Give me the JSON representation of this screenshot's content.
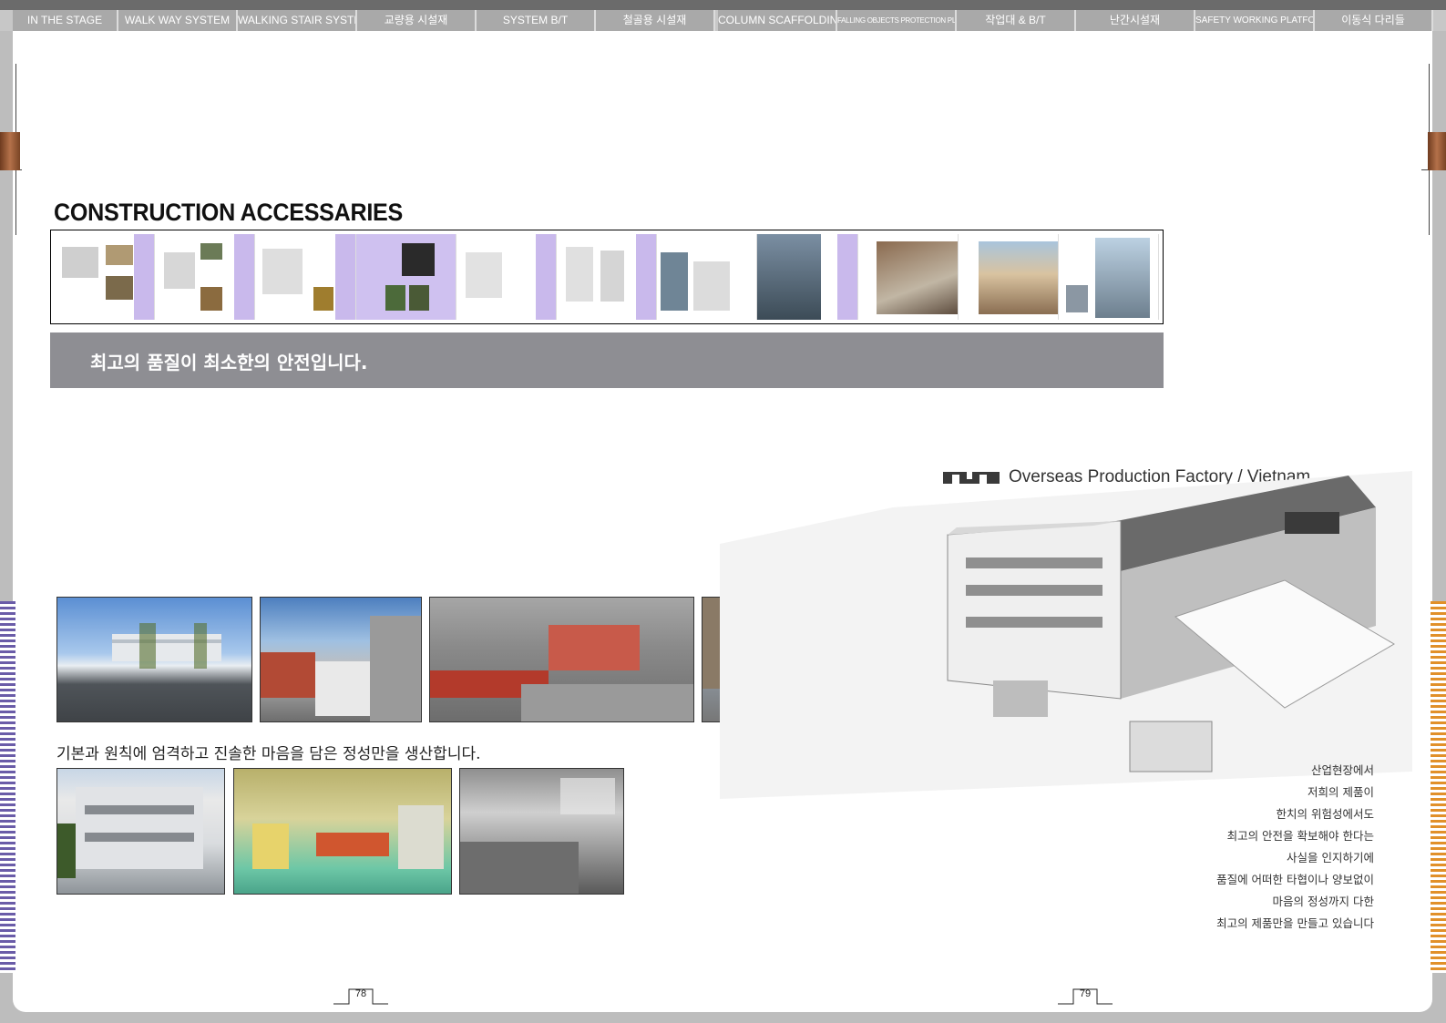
{
  "nav": {
    "tabs": [
      {
        "label": "IN THE STAGE"
      },
      {
        "label": "WALK WAY SYSTEM"
      },
      {
        "label": "WALKING STAIR SYSTEM"
      },
      {
        "label": "교량용 시설재"
      },
      {
        "label": "SYSTEM B/T"
      },
      {
        "label": "철골용 시설재"
      },
      {
        "label": "COLUMN SCAFFOLDING"
      },
      {
        "label": "FALLING OBJECTS PROTECTION PLATFORM"
      },
      {
        "label": "작업대 & B/T"
      },
      {
        "label": "난간시설재"
      },
      {
        "label": "SAFETY WORKING PLATFORM"
      },
      {
        "label": "이동식 다리들"
      }
    ]
  },
  "section": {
    "title": "CONSTRUCTION  ACCESSARIES",
    "banner": "최고의 품질이 최소한의 안전입니다."
  },
  "photos": {
    "caption": "기본과 원칙에 엄격하고 진솔한 마음을 담은 정성만을 생산합니다."
  },
  "factory": {
    "title": "Overseas Production Factory / Vietnam"
  },
  "poem": {
    "lines": [
      "산업현장에서",
      "저희의 제품이",
      "한치의 위험성에서도",
      "최고의 안전을 확보해야 한다는",
      "사실을 인지하기에",
      "품질에 어떠한 타협이나 양보없이",
      "마음의 정성까지 다한",
      "최고의 제품만을 만들고 있습니다"
    ]
  },
  "pages": {
    "left": "78",
    "right": "79"
  },
  "colors": {
    "banner": "#8e8e93",
    "tab": "#a9a9a9",
    "accent_left": "#6a5ca8",
    "accent_right": "#e1902a"
  }
}
